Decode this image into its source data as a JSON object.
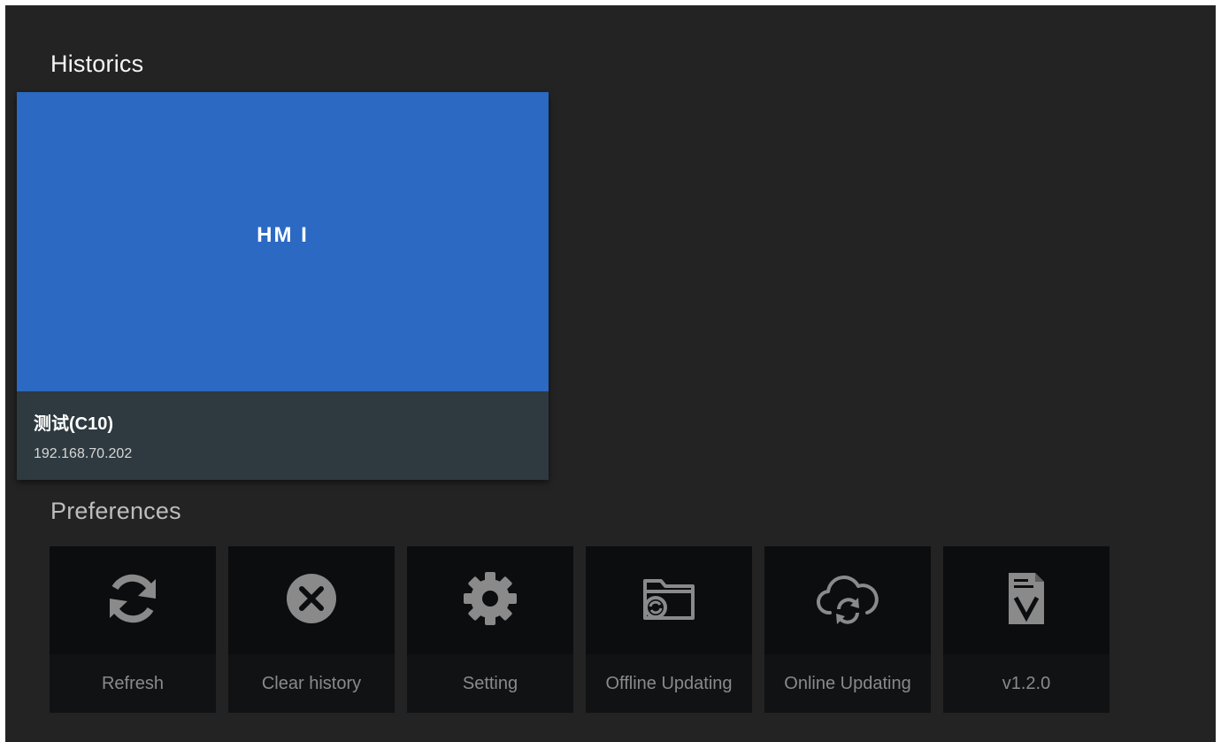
{
  "historics": {
    "title": "Historics",
    "cards": [
      {
        "preview_label": "HM I",
        "name": "测试(C10)",
        "ip": "192.168.70.202"
      }
    ]
  },
  "preferences": {
    "title": "Preferences",
    "items": [
      {
        "label": "Refresh",
        "icon": "refresh-icon"
      },
      {
        "label": "Clear history",
        "icon": "clear-circle-icon"
      },
      {
        "label": "Setting",
        "icon": "gear-icon"
      },
      {
        "label": "Offline Updating",
        "icon": "folder-sync-icon"
      },
      {
        "label": "Online Updating",
        "icon": "cloud-sync-icon"
      },
      {
        "label": "v1.2.0",
        "icon": "version-document-icon"
      }
    ]
  },
  "colors": {
    "background": "#232323",
    "card_preview": "#2b69c3",
    "card_info": "#2e3a40",
    "tile": "#0b0d0f",
    "icon": "#8a8a8a"
  }
}
